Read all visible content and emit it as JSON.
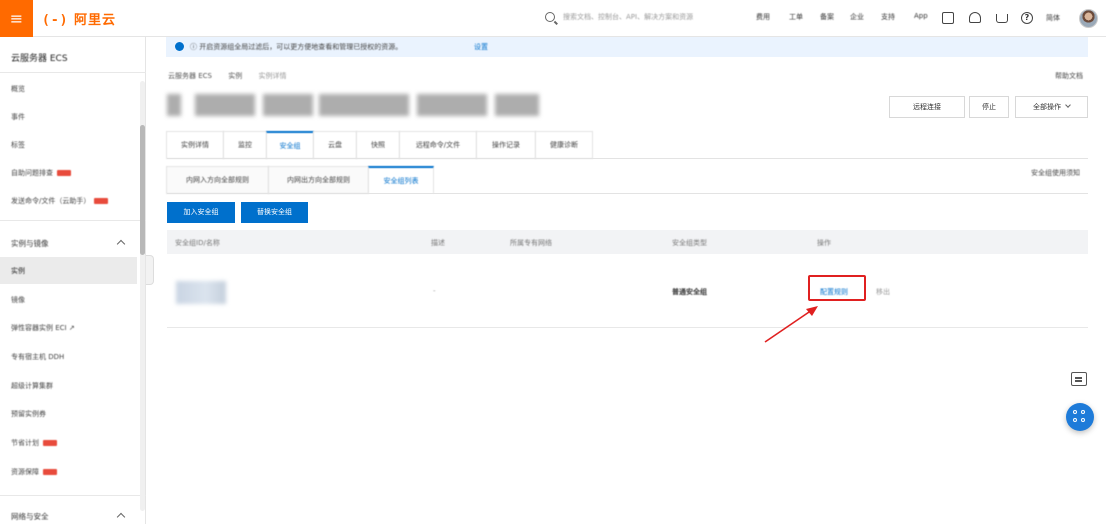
{
  "brand": {
    "menu_icon": "menu-icon",
    "logo_text": "阿里云",
    "logo_bracket": "(-)",
    "accent_color": "#ff6a00",
    "primary_color": "#0070cc"
  },
  "topbar": {
    "search_placeholder": "搜索文档、控制台、API、解决方案和资源",
    "nav": [
      "费用",
      "工单",
      "备案",
      "企业",
      "支持",
      "App"
    ],
    "account_label": "简体",
    "icons": [
      "search-icon",
      "screen-icon",
      "bell-icon",
      "cart-icon",
      "help-icon",
      "globe-icon",
      "avatar"
    ]
  },
  "sidebar": {
    "title": "云服务器 ECS",
    "items_top": [
      {
        "label": "概览"
      },
      {
        "label": "事件"
      },
      {
        "label": "标签"
      },
      {
        "label": "自助问题排查",
        "badge": "new"
      },
      {
        "label": "发送命令/文件（云助手）",
        "badge": "new"
      }
    ],
    "group1": "实例与镜像",
    "items_group1": [
      {
        "label": "实例",
        "active": true
      },
      {
        "label": "镜像"
      },
      {
        "label": "弹性容器实例 ECI ↗"
      },
      {
        "label": "专有宿主机 DDH"
      },
      {
        "label": "超级计算集群"
      },
      {
        "label": "预留实例券"
      },
      {
        "label": "节省计划",
        "badge": "new"
      },
      {
        "label": "资源保障",
        "badge": "new"
      }
    ],
    "group2": "网络与安全"
  },
  "notice": {
    "text": "ⓘ 开启资源组全局过滤后，可以更方便地查看和管理已授权的资源。",
    "link": "设置"
  },
  "breadcrumb": [
    "云服务器 ECS",
    "实例",
    "实例详情"
  ],
  "help_link": "帮助文档",
  "instance": {
    "header_buttons": [
      "远程连接",
      "停止",
      "全部操作"
    ]
  },
  "tabs_main": [
    {
      "label": "实例详情"
    },
    {
      "label": "监控"
    },
    {
      "label": "安全组",
      "active": true
    },
    {
      "label": "云盘"
    },
    {
      "label": "快照"
    },
    {
      "label": "远程命令/文件"
    },
    {
      "label": "操作记录"
    },
    {
      "label": "健康诊断"
    }
  ],
  "tabs_sub": [
    {
      "label": "内网入方向全部规则"
    },
    {
      "label": "内网出方向全部规则"
    },
    {
      "label": "安全组列表",
      "active": true
    }
  ],
  "sg_help": "安全组使用须知",
  "actions": {
    "join": "加入安全组",
    "replace": "替换安全组"
  },
  "table": {
    "headers": [
      "安全组ID/名称",
      "描述",
      "所属专有网络",
      "安全组类型",
      "操作"
    ],
    "rows": [
      {
        "id": "",
        "description": "-",
        "vpc": "",
        "type": "普通安全组",
        "action_primary": "配置规则",
        "action_secondary": "移出"
      }
    ]
  },
  "floating": {
    "chat_icon": "chat-icon",
    "apps_icon": "apps-icon"
  }
}
